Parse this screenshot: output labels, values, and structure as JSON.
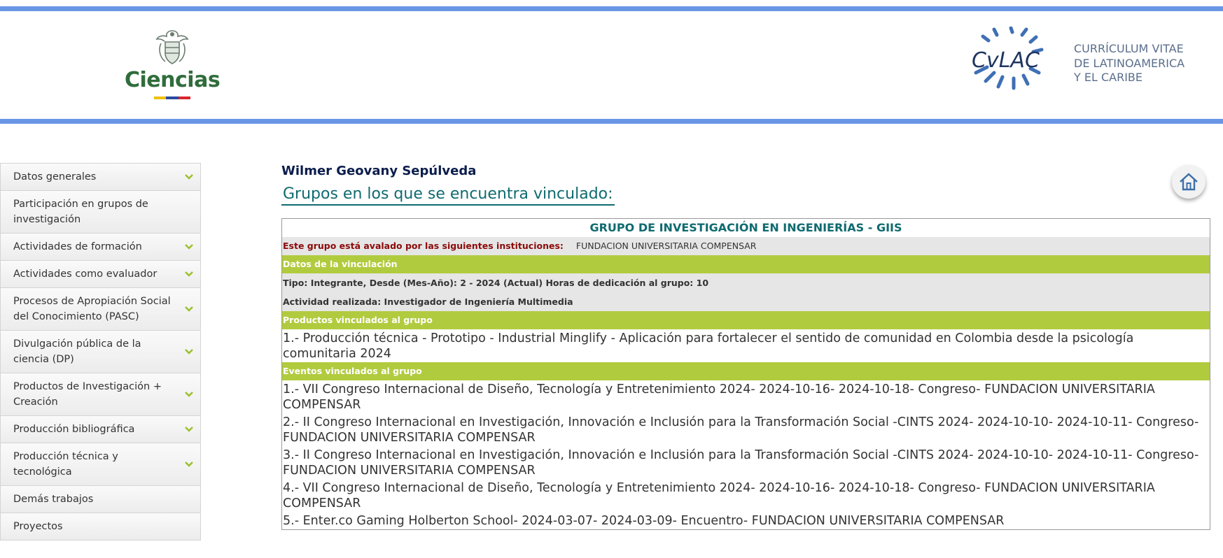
{
  "header": {
    "ciencias_logo_text": "Ciencias",
    "cvlac_logo_text": "CvLAC",
    "cvlac_lines": [
      "CURRÍCULUM VITAE",
      "DE LATINOAMERICA",
      "Y EL CARIBE"
    ],
    "flag_colors": [
      "#f2c00b",
      "#2a4aa0",
      "#d9262c"
    ]
  },
  "sidebar": {
    "items": [
      {
        "label": "Datos generales",
        "expandable": true
      },
      {
        "label": "Participación en grupos de investigación",
        "expandable": false
      },
      {
        "label": "Actividades de formación",
        "expandable": true
      },
      {
        "label": "Actividades como evaluador",
        "expandable": true
      },
      {
        "label": "Procesos de Apropiación Social del Conocimiento (PASC)",
        "expandable": true
      },
      {
        "label": "Divulgación pública de la ciencia (DP)",
        "expandable": true
      },
      {
        "label": "Productos de Investigación + Creación",
        "expandable": true
      },
      {
        "label": "Producción bibliográfica",
        "expandable": true
      },
      {
        "label": "Producción técnica y tecnológica",
        "expandable": true
      },
      {
        "label": "Demás trabajos",
        "expandable": false
      },
      {
        "label": "Proyectos",
        "expandable": false
      }
    ]
  },
  "main": {
    "person_name": "Wilmer Geovany Sepúlveda",
    "section_title": "Grupos en los que se encuentra vinculado:",
    "group": {
      "name": "GRUPO DE INVESTIGACIÓN EN INGENIERÍAS - GIIS",
      "institutions_label": "Este grupo está avalado por las siguientes instituciones:",
      "institutions_value": "FUNDACION UNIVERSITARIA COMPENSAR",
      "link_header": "Datos de la vinculación",
      "link_type": "Tipo: Integrante, Desde (Mes-Año): 2 - 2024 (Actual) Horas de dedicación al grupo: 10",
      "activity": "Actividad realizada: Investigador de Ingeniería Multimedia",
      "products_header": "Productos vinculados al grupo",
      "products": [
        "1.- Producción técnica - Prototipo - Industrial Minglify - Aplicación para fortalecer el sentido de comunidad en Colombia desde la psicología comunitaria 2024"
      ],
      "events_header": "Eventos vinculados al grupo",
      "events": [
        "1.- VII Congreso Internacional de Diseño, Tecnología y Entretenimiento 2024- 2024-10-16- 2024-10-18- Congreso- FUNDACION UNIVERSITARIA COMPENSAR",
        "2.- II Congreso Internacional en Investigación, Innovación e Inclusión para la Transformación Social -CINTS 2024- 2024-10-10- 2024-10-11- Congreso- FUNDACION UNIVERSITARIA COMPENSAR",
        "3.- II Congreso Internacional en Investigación, Innovación e Inclusión para la Transformación Social -CINTS 2024- 2024-10-10- 2024-10-11- Congreso- FUNDACION UNIVERSITARIA COMPENSAR",
        "4.- VII Congreso Internacional de Diseño, Tecnología y Entretenimiento 2024- 2024-10-16- 2024-10-18- Congreso- FUNDACION UNIVERSITARIA COMPENSAR",
        "5.- Enter.co Gaming Holberton School- 2024-03-07- 2024-03-09- Encuentro- FUNDACION UNIVERSITARIA COMPENSAR"
      ]
    }
  },
  "home_button": {
    "icon": "home-icon"
  },
  "colors": {
    "header_bar": "#6a96e6",
    "green_bar": "#b1cb3f",
    "title_teal": "#0f6b6f",
    "chevron": "#9bc12f"
  }
}
